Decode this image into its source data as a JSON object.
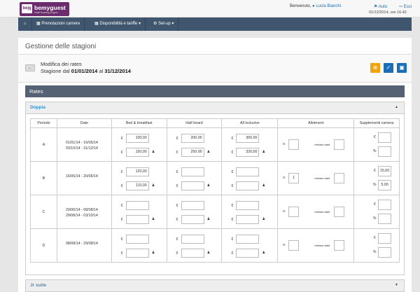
{
  "header": {
    "logo_badge": "be|g",
    "logo_name": "bemyguest",
    "logo_tagline": "Hotel Booking Engine",
    "welcome": "Benvenuto,",
    "user": "Lucia Bianchi",
    "lang": "Auto",
    "exit": "Esci",
    "datetime": "01/12/2014, ore 16.42"
  },
  "nav": {
    "home_icon": "home-icon",
    "items": [
      {
        "label": "Prenotazioni camere"
      },
      {
        "label": "Disponibilità e tariffe",
        "dropdown": true
      },
      {
        "label": "Set-up",
        "dropdown": true
      }
    ]
  },
  "page": {
    "title": "Gestione delle stagioni",
    "edit_title": "Modifica dei rates",
    "season_prefix": "Stagione dal",
    "season_from": "01/01/2014",
    "season_mid": "al",
    "season_to": "31/12/2014",
    "colors": {
      "cancel": "#f0a30a",
      "confirm": "#1a6fb5",
      "save": "#1a6fb5"
    }
  },
  "rates": {
    "heading": "Rates",
    "room1": "Doppia",
    "room2": "Jr suite",
    "columns": [
      "Periodo",
      "Date",
      "Bed & breakfast",
      "Half board",
      "All inclusive",
      "Allotment",
      "Supplementi camera"
    ],
    "currency": "€",
    "n_label": "n.",
    "release_label": "release date",
    "percent_label": "%",
    "rows": [
      {
        "period": "A",
        "date1": "01/01/14 - 16/05/14",
        "date2": "03/10/14 - 31/12/14",
        "bb1": "100,00",
        "bb2": "150,00",
        "hb1": "200,00",
        "hb2": "250,00",
        "ai1": "300,00",
        "ai2": "320,00",
        "n": "",
        "release": "",
        "supp1": "",
        "supp2": ""
      },
      {
        "period": "B",
        "date1": "16/05/14 - 20/06/14",
        "date2": "",
        "bb1": "120,00",
        "bb2": "110,00",
        "hb1": "",
        "hb2": "",
        "ai1": "",
        "ai2": "",
        "n": "1",
        "release": "",
        "supp1": "15,00",
        "supp2": "5,00"
      },
      {
        "period": "C",
        "date1": "20/06/14 - 08/08/14",
        "date2": "29/08/14 - 03/10/14",
        "bb1": "",
        "bb2": "",
        "hb1": "",
        "hb2": "",
        "ai1": "",
        "ai2": "",
        "n": "",
        "release": "",
        "supp1": "",
        "supp2": ""
      },
      {
        "period": "D",
        "date1": "08/08/14 - 29/08/14",
        "date2": "",
        "bb1": "",
        "bb2": "",
        "hb1": "",
        "hb2": "",
        "ai1": "",
        "ai2": "",
        "n": "",
        "release": "",
        "supp1": "",
        "supp2": ""
      }
    ]
  }
}
